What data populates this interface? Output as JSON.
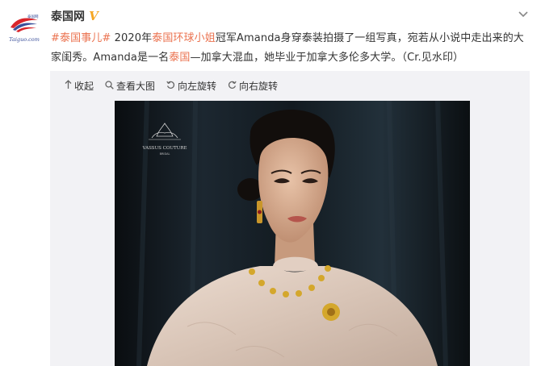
{
  "account": {
    "name": "泰国网",
    "verified_badge": "V",
    "avatar_logo_text": "Taiguo.com",
    "avatar_small_text": "泰国网"
  },
  "post": {
    "hashtag": "#泰国事儿#",
    "t1": " 2020年",
    "link1": "泰国环球小姐",
    "t2": "冠军Amanda身穿泰装拍摄了一组写真，宛若从小说中走出来的大家闺秀。Amanda是一名",
    "link2": "泰国",
    "t3": "—加拿大混血，她毕业于加拿大多伦多大学。（Cr.见水印）"
  },
  "toolbar": {
    "collapse": "收起",
    "view_large": "查看大图",
    "rotate_left": "向左旋转",
    "rotate_right": "向右旋转"
  },
  "photo": {
    "watermark_brand": "VASSUS COUTURE",
    "watermark_sub": "BRIDAL"
  },
  "colors": {
    "link": "#eb7350",
    "badge": "#f5a623",
    "toolbar_bg": "#f2f2f5",
    "text": "#333333"
  },
  "icons": [
    "more-chevron-icon",
    "collapse-arrow-icon",
    "zoom-search-icon",
    "rotate-left-icon",
    "rotate-right-icon",
    "verified-v-icon"
  ]
}
